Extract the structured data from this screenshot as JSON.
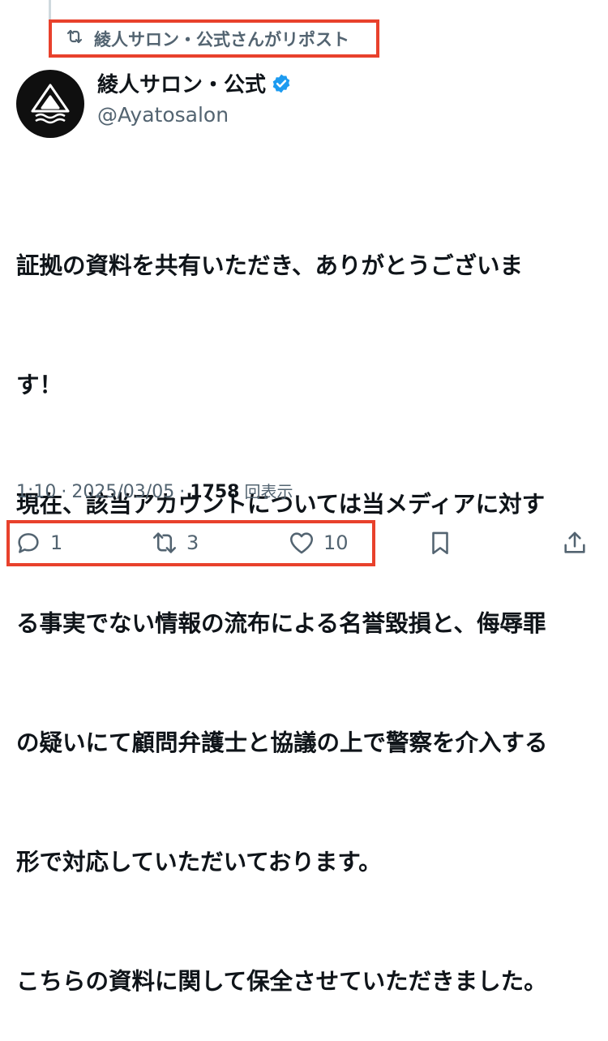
{
  "repost_banner": {
    "text": "綾人サロン・公式さんがリポスト"
  },
  "author": {
    "display_name": "綾人サロン・公式",
    "handle": "@Ayatosalon",
    "verified": true
  },
  "tweet": {
    "lines": [
      "証拠の資料を共有いただき、ありがとうございま",
      "す！",
      "現在、該当アカウントについては当メディアに対す",
      "る事実でない情報の流布による名誉毀損と、侮辱罪",
      "の疑いにて顧問弁護士と協議の上で警察を介入する",
      "形で対応していただいております。",
      "こちらの資料に関して保全させていただきました。"
    ]
  },
  "meta": {
    "time": "1:10",
    "sep": "·",
    "date": "2025/03/05",
    "views": "1758",
    "views_label": "回表示"
  },
  "actions": {
    "replies": "1",
    "reposts": "3",
    "likes": "10"
  },
  "colors": {
    "highlight": "#e8412c",
    "verified": "#1d9bf0",
    "muted": "#536471",
    "text": "#0f1419"
  },
  "icons": [
    "repost-icon",
    "verified-badge-icon",
    "reply-icon",
    "like-icon",
    "bookmark-icon",
    "share-icon"
  ]
}
